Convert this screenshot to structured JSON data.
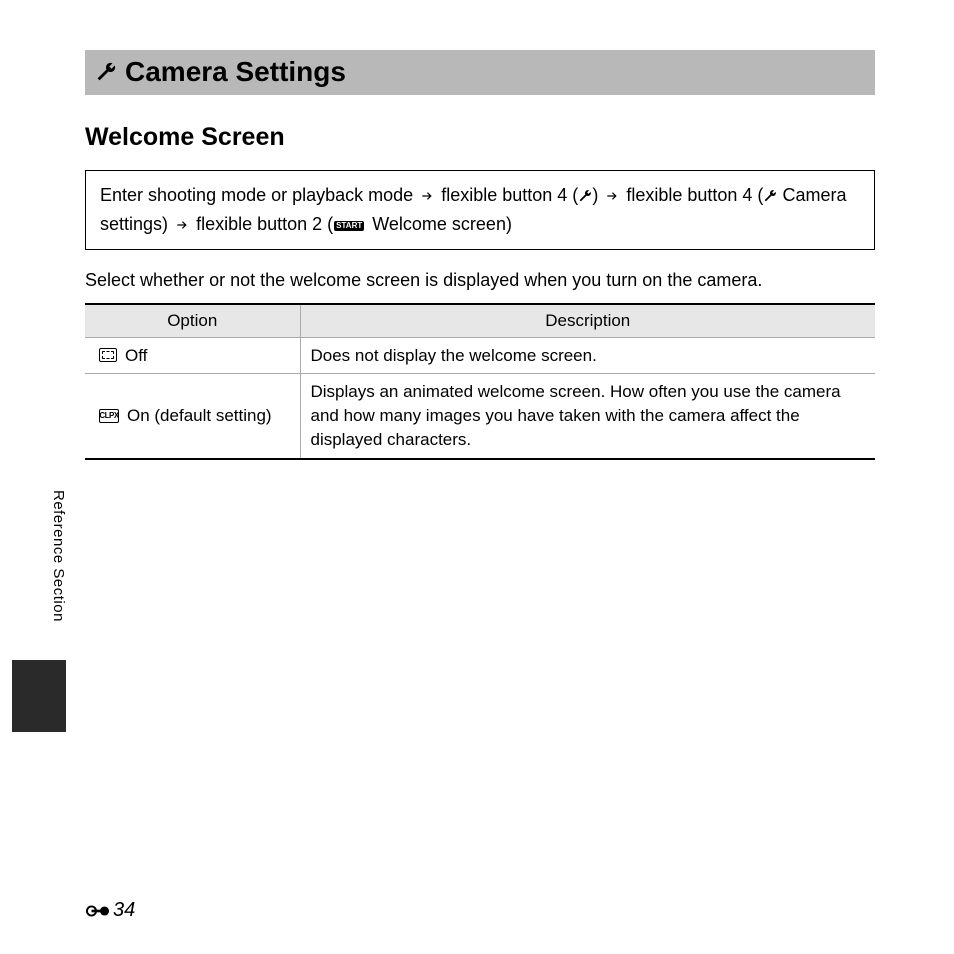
{
  "header": {
    "title": "Camera Settings"
  },
  "subheading": "Welcome Screen",
  "navbox": {
    "seg1": "Enter shooting mode or playback mode",
    "seg2": "flexible button 4 (",
    "seg3": ")",
    "seg4": "flexible button 4 (",
    "seg5": " Camera settings)",
    "seg6": "flexible button 2 (",
    "start_label": "START",
    "seg7": " Welcome screen)"
  },
  "intro": "Select whether or not the welcome screen is displayed when you turn on the camera.",
  "table": {
    "headers": {
      "option": "Option",
      "description": "Description"
    },
    "rows": [
      {
        "option_label": "Off",
        "icon_text": "",
        "description": "Does not display the welcome screen."
      },
      {
        "option_label": "On (default setting)",
        "icon_text": "CLPX",
        "description": "Displays an animated welcome screen. How often you use the camera and how many images you have taken with the camera affect the displayed characters."
      }
    ]
  },
  "side_label": "Reference Section",
  "page_number": "34"
}
